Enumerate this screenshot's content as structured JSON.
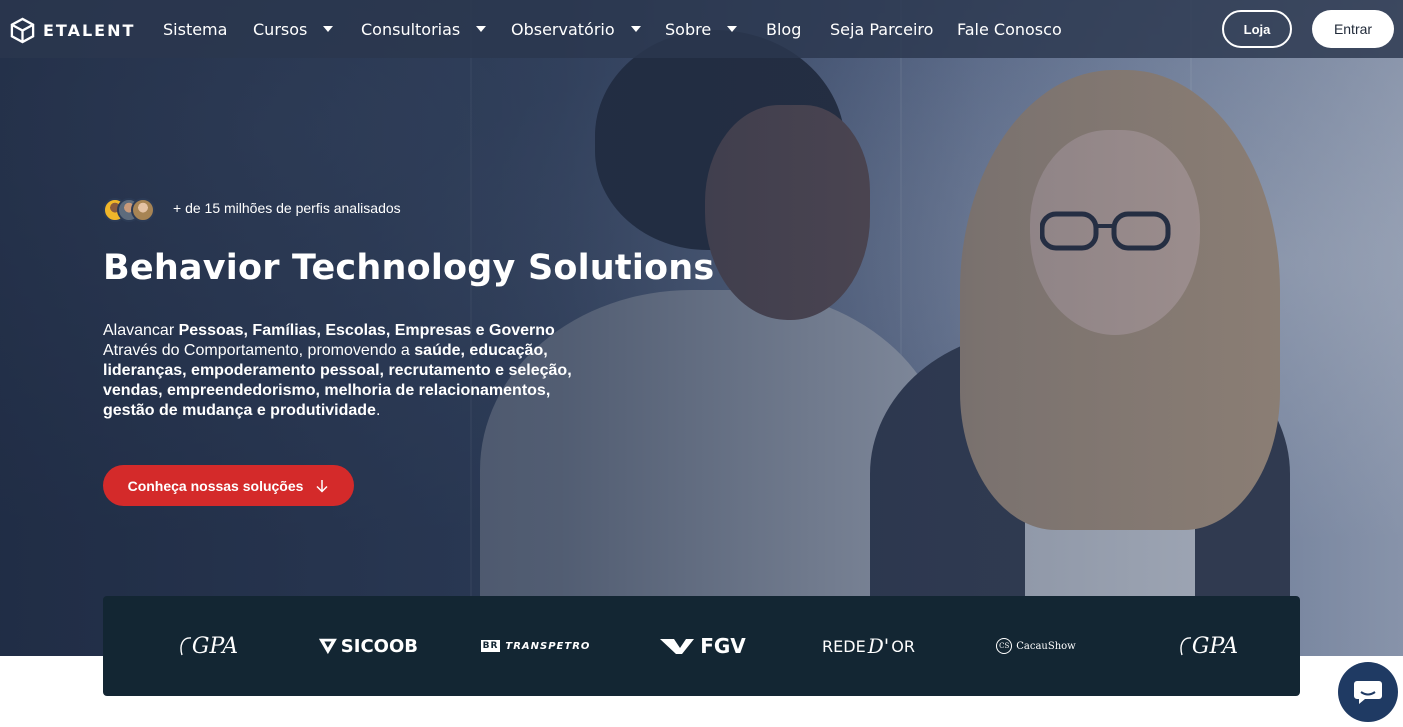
{
  "brand": {
    "name": "ETALENT"
  },
  "nav": {
    "items": [
      {
        "label": "Sistema",
        "dropdown": false
      },
      {
        "label": "Cursos",
        "dropdown": true
      },
      {
        "label": "Consultorias",
        "dropdown": true
      },
      {
        "label": "Observatório",
        "dropdown": true
      },
      {
        "label": "Sobre",
        "dropdown": true
      },
      {
        "label": "Blog",
        "dropdown": false
      },
      {
        "label": "Seja Parceiro",
        "dropdown": false
      },
      {
        "label": "Fale Conosco",
        "dropdown": false
      }
    ],
    "store_label": "Loja",
    "login_label": "Entrar"
  },
  "hero": {
    "profiles_text": "+ de 15 milhões de perfis analisados",
    "title": "Behavior Technology Solutions",
    "desc_prefix": "Alavancar ",
    "desc_bold1": "Pessoas, Famílias, Escolas, Empresas e Governo",
    "desc_mid": "Através do Comportamento, promovendo a ",
    "desc_bold2": "saúde, educação, lideranças, empoderamento pessoal, recrutamento e seleção, vendas, empreendedorismo, melhoria de relacionamentos, gestão de mudança e produtividade",
    "desc_suffix": ".",
    "cta_label": "Conheça nossas soluções",
    "cta_icon": "arrow-down-icon"
  },
  "partners": {
    "gpa": "GPA",
    "sicoob": "SICOOB",
    "transpetro_mark": "BR",
    "transpetro": "TRANSPETRO",
    "fgv": "FGV",
    "rededor_a": "REDE",
    "rededor_b": "D'",
    "rededor_c": "OR",
    "cacau_mark": "CS",
    "cacau": "CacauShow"
  },
  "chat": {
    "icon": "chat-bubble-icon"
  },
  "colors": {
    "navbar": "#2b374e",
    "cta": "#d42a2a",
    "logo_strip": "#132633",
    "chat": "#1f3a63"
  }
}
